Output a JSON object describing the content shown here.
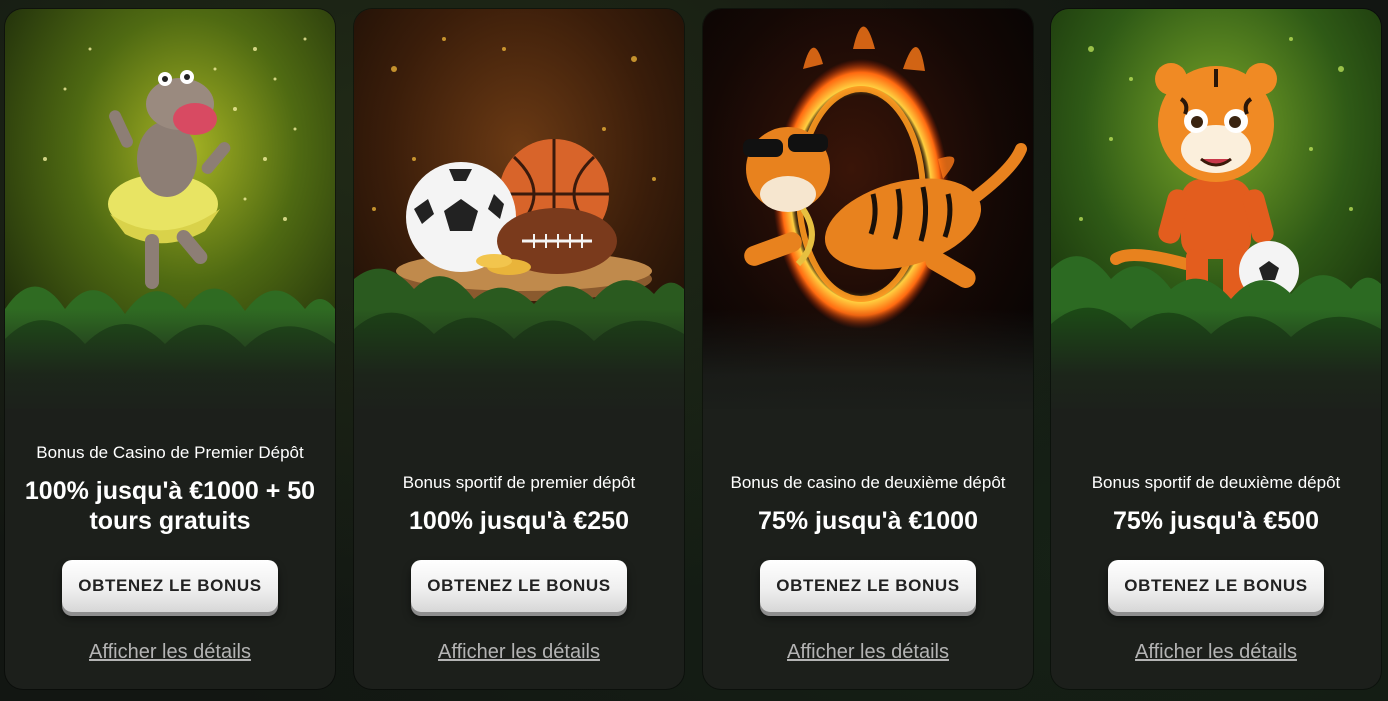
{
  "cards": [
    {
      "subtitle": "Bonus de Casino de Premier Dépôt",
      "headline_line1": "100% jusqu'à €1000 + 50",
      "headline_line2": "tours gratuits",
      "button_label": "OBTENEZ LE BONUS",
      "details_label": "Afficher les détails",
      "art_icon": "hippo-dancer-icon"
    },
    {
      "subtitle": "Bonus sportif de premier dépôt",
      "headline_line1": "100% jusqu'à €250",
      "button_label": "OBTENEZ LE BONUS",
      "details_label": "Afficher les détails",
      "art_icon": "sports-balls-icon"
    },
    {
      "subtitle": "Bonus de casino de deuxième dépôt",
      "headline_line1": "75% jusqu'à €1000",
      "button_label": "OBTENEZ LE BONUS",
      "details_label": "Afficher les détails",
      "art_icon": "tiger-fire-ring-icon"
    },
    {
      "subtitle": "Bonus sportif de deuxième dépôt",
      "headline_line1": "75% jusqu'à €500",
      "button_label": "OBTENEZ LE BONUS",
      "details_label": "Afficher les détails",
      "art_icon": "tiger-football-icon"
    }
  ],
  "colors": {
    "card_bg": "#1c1f1b",
    "button_bg": "#f2f2f2",
    "button_text": "#222222",
    "details_link": "#b4b4b4"
  }
}
